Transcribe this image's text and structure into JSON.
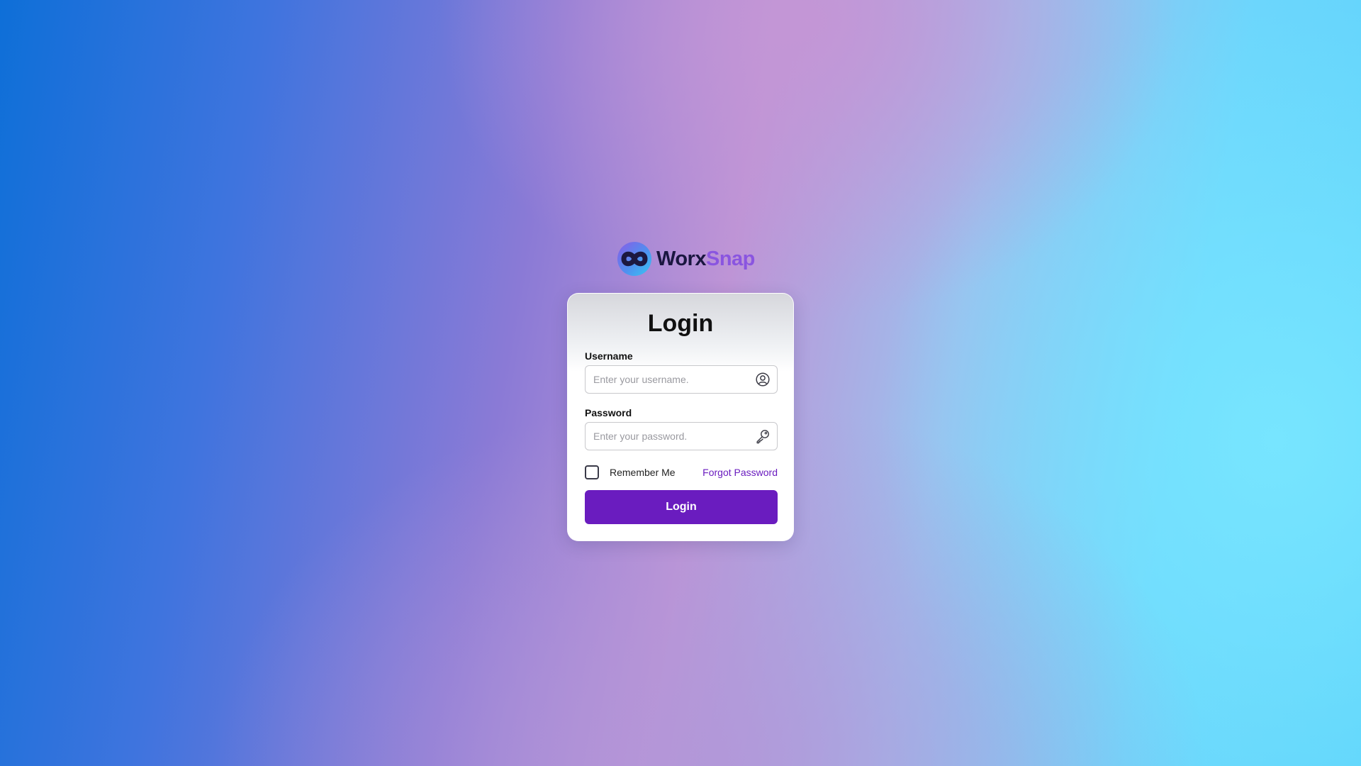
{
  "brand": {
    "name_part1": "Worx",
    "name_part2": "Snap",
    "logo_icon": "infinity-logo-icon",
    "colors": {
      "dark": "#1a1640",
      "accent": "#8a55e0"
    }
  },
  "login": {
    "title": "Login",
    "username_label": "Username",
    "username_placeholder": "Enter your username.",
    "username_value": "",
    "username_icon": "user-circle-icon",
    "password_label": "Password",
    "password_placeholder": "Enter your password.",
    "password_value": "",
    "password_icon": "key-icon",
    "remember_label": "Remember Me",
    "remember_checked": false,
    "forgot_label": "Forgot Password",
    "button_label": "Login",
    "accent_color": "#6a1cbf"
  }
}
